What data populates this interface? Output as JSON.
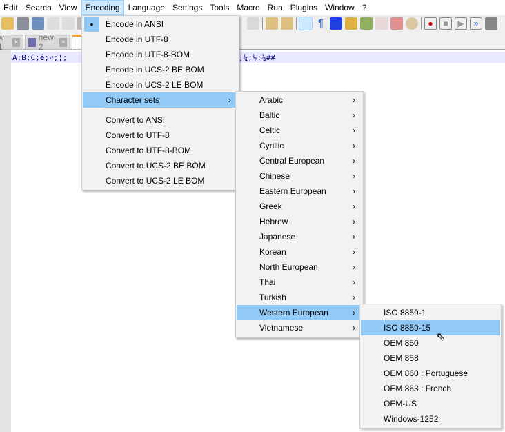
{
  "menubar": [
    "Edit",
    "Search",
    "View",
    "Encoding",
    "Language",
    "Settings",
    "Tools",
    "Macro",
    "Run",
    "Plugins",
    "Window",
    "?"
  ],
  "tabs": [
    {
      "label": "w 1"
    },
    {
      "label": "new 2"
    }
  ],
  "editor": {
    "line_start": "A;B;C;é;¤;¦;",
    "line_end": ";¼;½;¾##"
  },
  "encoding_menu": {
    "encode_items": [
      "Encode in ANSI",
      "Encode in UTF-8",
      "Encode in UTF-8-BOM",
      "Encode in UCS-2 BE BOM",
      "Encode in UCS-2 LE BOM"
    ],
    "character_sets": "Character sets",
    "convert_items": [
      "Convert to ANSI",
      "Convert to UTF-8",
      "Convert to UTF-8-BOM",
      "Convert to UCS-2 BE BOM",
      "Convert to UCS-2 LE BOM"
    ],
    "selected": "Encode in ANSI"
  },
  "charset_menu": [
    "Arabic",
    "Baltic",
    "Celtic",
    "Cyrillic",
    "Central European",
    "Chinese",
    "Eastern European",
    "Greek",
    "Hebrew",
    "Japanese",
    "Korean",
    "North European",
    "Thai",
    "Turkish",
    "Western European",
    "Vietnamese"
  ],
  "western_menu": [
    "ISO 8859-1",
    "ISO 8859-15",
    "OEM 850",
    "OEM 858",
    "OEM 860 : Portuguese",
    "OEM 863 : French",
    "OEM-US",
    "Windows-1252"
  ],
  "colors": {
    "highlight": "#91c9f7"
  }
}
